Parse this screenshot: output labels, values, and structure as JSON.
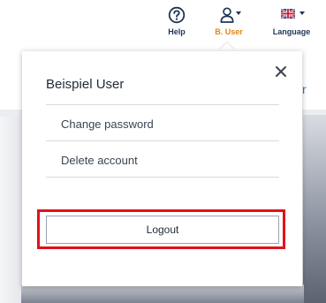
{
  "topnav": {
    "help": {
      "label": "Help",
      "icon": "help-icon"
    },
    "user": {
      "label": "B. User",
      "icon": "user-icon",
      "active_color": "#e8820c"
    },
    "language": {
      "label": "Language",
      "icon": "uk-flag-icon"
    }
  },
  "popup": {
    "title": "Beispiel User",
    "close_icon": "close-icon",
    "menu": [
      {
        "label": "Change password"
      },
      {
        "label": "Delete account"
      }
    ],
    "logout_label": "Logout",
    "highlight_color": "#e0121b"
  },
  "background": {
    "partial_letter": "r"
  }
}
